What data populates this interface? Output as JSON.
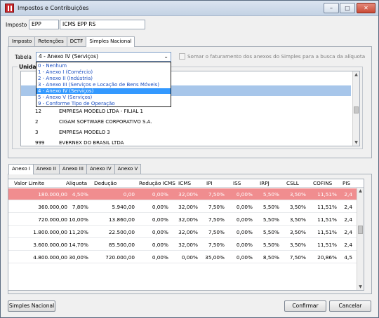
{
  "window": {
    "title": "Impostos e Contribuições",
    "min": "–",
    "max": "□",
    "close": "✕"
  },
  "imposto": {
    "label": "Imposto",
    "code": "EPP",
    "description": "ICMS EPP RS"
  },
  "top_tabs": [
    "Imposto",
    "Retenções",
    "DCTF",
    "Simples Nacional"
  ],
  "tabela": {
    "label": "Tabela",
    "selected": "4 - Anexo IV (Serviços)",
    "options": [
      "0 - Nenhum",
      "1 - Anexo I (Comércio)",
      "2 - Anexo II (Indústria)",
      "3 - Anexo III (Serviços e Locação de Bens Móveis)",
      "4 - Anexo IV (Serviços)",
      "5 - Anexo V (Serviços)",
      "9 - Conforme Tipo de Operação"
    ],
    "selected_index": 4
  },
  "somar_checkbox": {
    "label": "Somar o faturamento dos anexos do Simples para a busca da alíquota",
    "checked": false
  },
  "unidades": {
    "title": "Unidad",
    "rows": [
      {
        "code": "12",
        "name": "EMPRESA MODELO LTDA - FILIAL 1"
      },
      {
        "code": "2",
        "name": "CIGAM SOFTWARE CORPORATIVO S.A."
      },
      {
        "code": "3",
        "name": "EMPRESA MODELO 3"
      },
      {
        "code": "999",
        "name": "EVERNEX DO BRASIL LTDA"
      }
    ]
  },
  "anexo_tabs": [
    "Anexo I",
    "Anexo II",
    "Anexo III",
    "Anexo IV",
    "Anexo V"
  ],
  "grid": {
    "headers": [
      "Valor Limite",
      "Alíquota",
      "Dedução",
      "Redução ICMS",
      "ICMS",
      "IPI",
      "ISS",
      "IRPJ",
      "CSLL",
      "COFINS",
      "PIS"
    ],
    "rows": [
      [
        "180.000,00",
        "4,50%",
        "0,00",
        "0,00%",
        "32,00%",
        "7,50%",
        "0,00%",
        "5,50%",
        "3,50%",
        "11,51%",
        "2,4"
      ],
      [
        "360.000,00",
        "7,80%",
        "5.940,00",
        "0,00%",
        "32,00%",
        "7,50%",
        "0,00%",
        "5,50%",
        "3,50%",
        "11,51%",
        "2,4"
      ],
      [
        "720.000,00",
        "10,00%",
        "13.860,00",
        "0,00%",
        "32,00%",
        "7,50%",
        "0,00%",
        "5,50%",
        "3,50%",
        "11,51%",
        "2,4"
      ],
      [
        "1.800.000,00",
        "11,20%",
        "22.500,00",
        "0,00%",
        "32,00%",
        "7,50%",
        "0,00%",
        "5,50%",
        "3,50%",
        "11,51%",
        "2,4"
      ],
      [
        "3.600.000,00",
        "14,70%",
        "85.500,00",
        "0,00%",
        "32,00%",
        "7,50%",
        "0,00%",
        "5,50%",
        "3,50%",
        "11,51%",
        "2,4"
      ],
      [
        "4.800.000,00",
        "30,00%",
        "720.000,00",
        "0,00%",
        "0,00%",
        "35,00%",
        "0,00%",
        "8,50%",
        "7,50%",
        "20,86%",
        "4,5"
      ]
    ]
  },
  "buttons": {
    "simples": "Simples Nacional",
    "confirmar": "Confirmar",
    "cancelar": "Cancelar"
  },
  "colors": {
    "highlight_row": "#f08d8f",
    "selection": "#3399ff",
    "list_selection": "#a7c6ea"
  }
}
